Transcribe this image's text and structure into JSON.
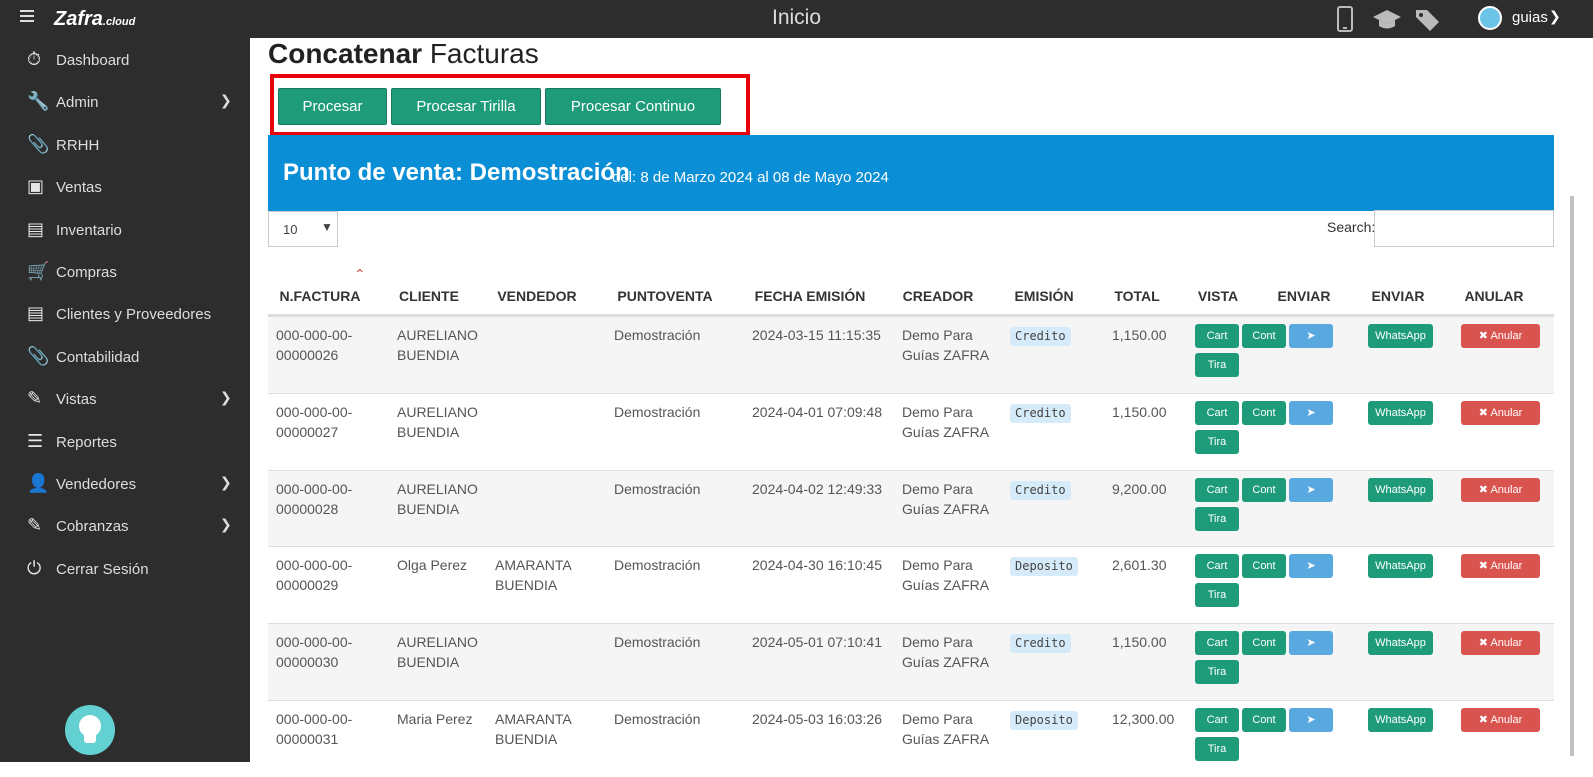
{
  "topbar": {
    "logo_main": "Zafra",
    "logo_suffix": ".cloud",
    "title": "Inicio",
    "user": "guias",
    "icons": [
      "phone-icon",
      "graduation-cap-icon",
      "tags-icon",
      "avatar-icon",
      "chevron-down-icon"
    ]
  },
  "sidebar": {
    "items": [
      {
        "label": "Dashboard",
        "icon": "dashboard-icon",
        "has_arrow": false
      },
      {
        "label": "Admin",
        "icon": "wrench-icon",
        "has_arrow": true
      },
      {
        "label": "RRHH",
        "icon": "paperclip-icon",
        "has_arrow": false
      },
      {
        "label": "Ventas",
        "icon": "money-icon",
        "has_arrow": false
      },
      {
        "label": "Inventario",
        "icon": "book-icon",
        "has_arrow": false
      },
      {
        "label": "Compras",
        "icon": "cart-icon",
        "has_arrow": false
      },
      {
        "label": "Clientes y Proveedores",
        "icon": "book-icon",
        "has_arrow": false
      },
      {
        "label": "Contabilidad",
        "icon": "paperclip-icon",
        "has_arrow": false
      },
      {
        "label": "Vistas",
        "icon": "edit-icon",
        "has_arrow": true
      },
      {
        "label": "Reportes",
        "icon": "list-icon",
        "has_arrow": false
      },
      {
        "label": "Vendedores",
        "icon": "user-icon",
        "has_arrow": true
      },
      {
        "label": "Cobranzas",
        "icon": "edit-icon",
        "has_arrow": true
      },
      {
        "label": "Cerrar Sesión",
        "icon": "power-icon",
        "has_arrow": false
      }
    ]
  },
  "main": {
    "title_bold": "Concatenar",
    "title_rest": "Facturas",
    "buttons": [
      "Procesar",
      "Procesar Tirilla",
      "Procesar Continuo"
    ],
    "banner_title": "Punto de venta: Demostración",
    "banner_range": "del: 8 de Marzo 2024 al 08 de Mayo 2024",
    "page_size": "10",
    "search_label": "Search:",
    "columns": [
      "N.FACTURA",
      "CLIENTE",
      "VENDEDOR",
      "PUNTOVENTA",
      "FECHA EMISIÓN",
      "CREADOR",
      "EMISIÓN",
      "TOTAL",
      "VISTA",
      "ENVIAR",
      "ENVIAR",
      "ANULAR"
    ],
    "row_buttons": {
      "cart": "Cart",
      "cont": "Cont",
      "tira": "Tira",
      "whatsapp": "WhatsApp",
      "anular": "Anular"
    },
    "rows": [
      {
        "factura_1": "000-000-00-",
        "factura_2": "00000026",
        "cliente_1": "AURELIANO",
        "cliente_2": "BUENDIA",
        "vendedor_1": "",
        "vendedor_2": "",
        "punto": "Demostración",
        "fecha": "2024-03-15 11:15:35",
        "creador_1": "Demo Para",
        "creador_2": "Guías ZAFRA",
        "emision": "Credito",
        "total": "1,150.00"
      },
      {
        "factura_1": "000-000-00-",
        "factura_2": "00000027",
        "cliente_1": "AURELIANO",
        "cliente_2": "BUENDIA",
        "vendedor_1": "",
        "vendedor_2": "",
        "punto": "Demostración",
        "fecha": "2024-04-01 07:09:48",
        "creador_1": "Demo Para",
        "creador_2": "Guías ZAFRA",
        "emision": "Credito",
        "total": "1,150.00"
      },
      {
        "factura_1": "000-000-00-",
        "factura_2": "00000028",
        "cliente_1": "AURELIANO",
        "cliente_2": "BUENDIA",
        "vendedor_1": "",
        "vendedor_2": "",
        "punto": "Demostración",
        "fecha": "2024-04-02 12:49:33",
        "creador_1": "Demo Para",
        "creador_2": "Guías ZAFRA",
        "emision": "Credito",
        "total": "9,200.00"
      },
      {
        "factura_1": "000-000-00-",
        "factura_2": "00000029",
        "cliente_1": "Olga Perez",
        "cliente_2": "",
        "vendedor_1": "AMARANTA",
        "vendedor_2": "BUENDIA",
        "punto": "Demostración",
        "fecha": "2024-04-30 16:10:45",
        "creador_1": "Demo Para",
        "creador_2": "Guías ZAFRA",
        "emision": "Deposito",
        "total": "2,601.30"
      },
      {
        "factura_1": "000-000-00-",
        "factura_2": "00000030",
        "cliente_1": "AURELIANO",
        "cliente_2": "BUENDIA",
        "vendedor_1": "",
        "vendedor_2": "",
        "punto": "Demostración",
        "fecha": "2024-05-01 07:10:41",
        "creador_1": "Demo Para",
        "creador_2": "Guías ZAFRA",
        "emision": "Credito",
        "total": "1,150.00"
      },
      {
        "factura_1": "000-000-00-",
        "factura_2": "00000031",
        "cliente_1": "Maria Perez",
        "cliente_2": "",
        "vendedor_1": "AMARANTA",
        "vendedor_2": "BUENDIA",
        "punto": "Demostración",
        "fecha": "2024-05-03 16:03:26",
        "creador_1": "Demo Para",
        "creador_2": "Guías ZAFRA",
        "emision": "Deposito",
        "total": "12,300.00"
      }
    ]
  }
}
